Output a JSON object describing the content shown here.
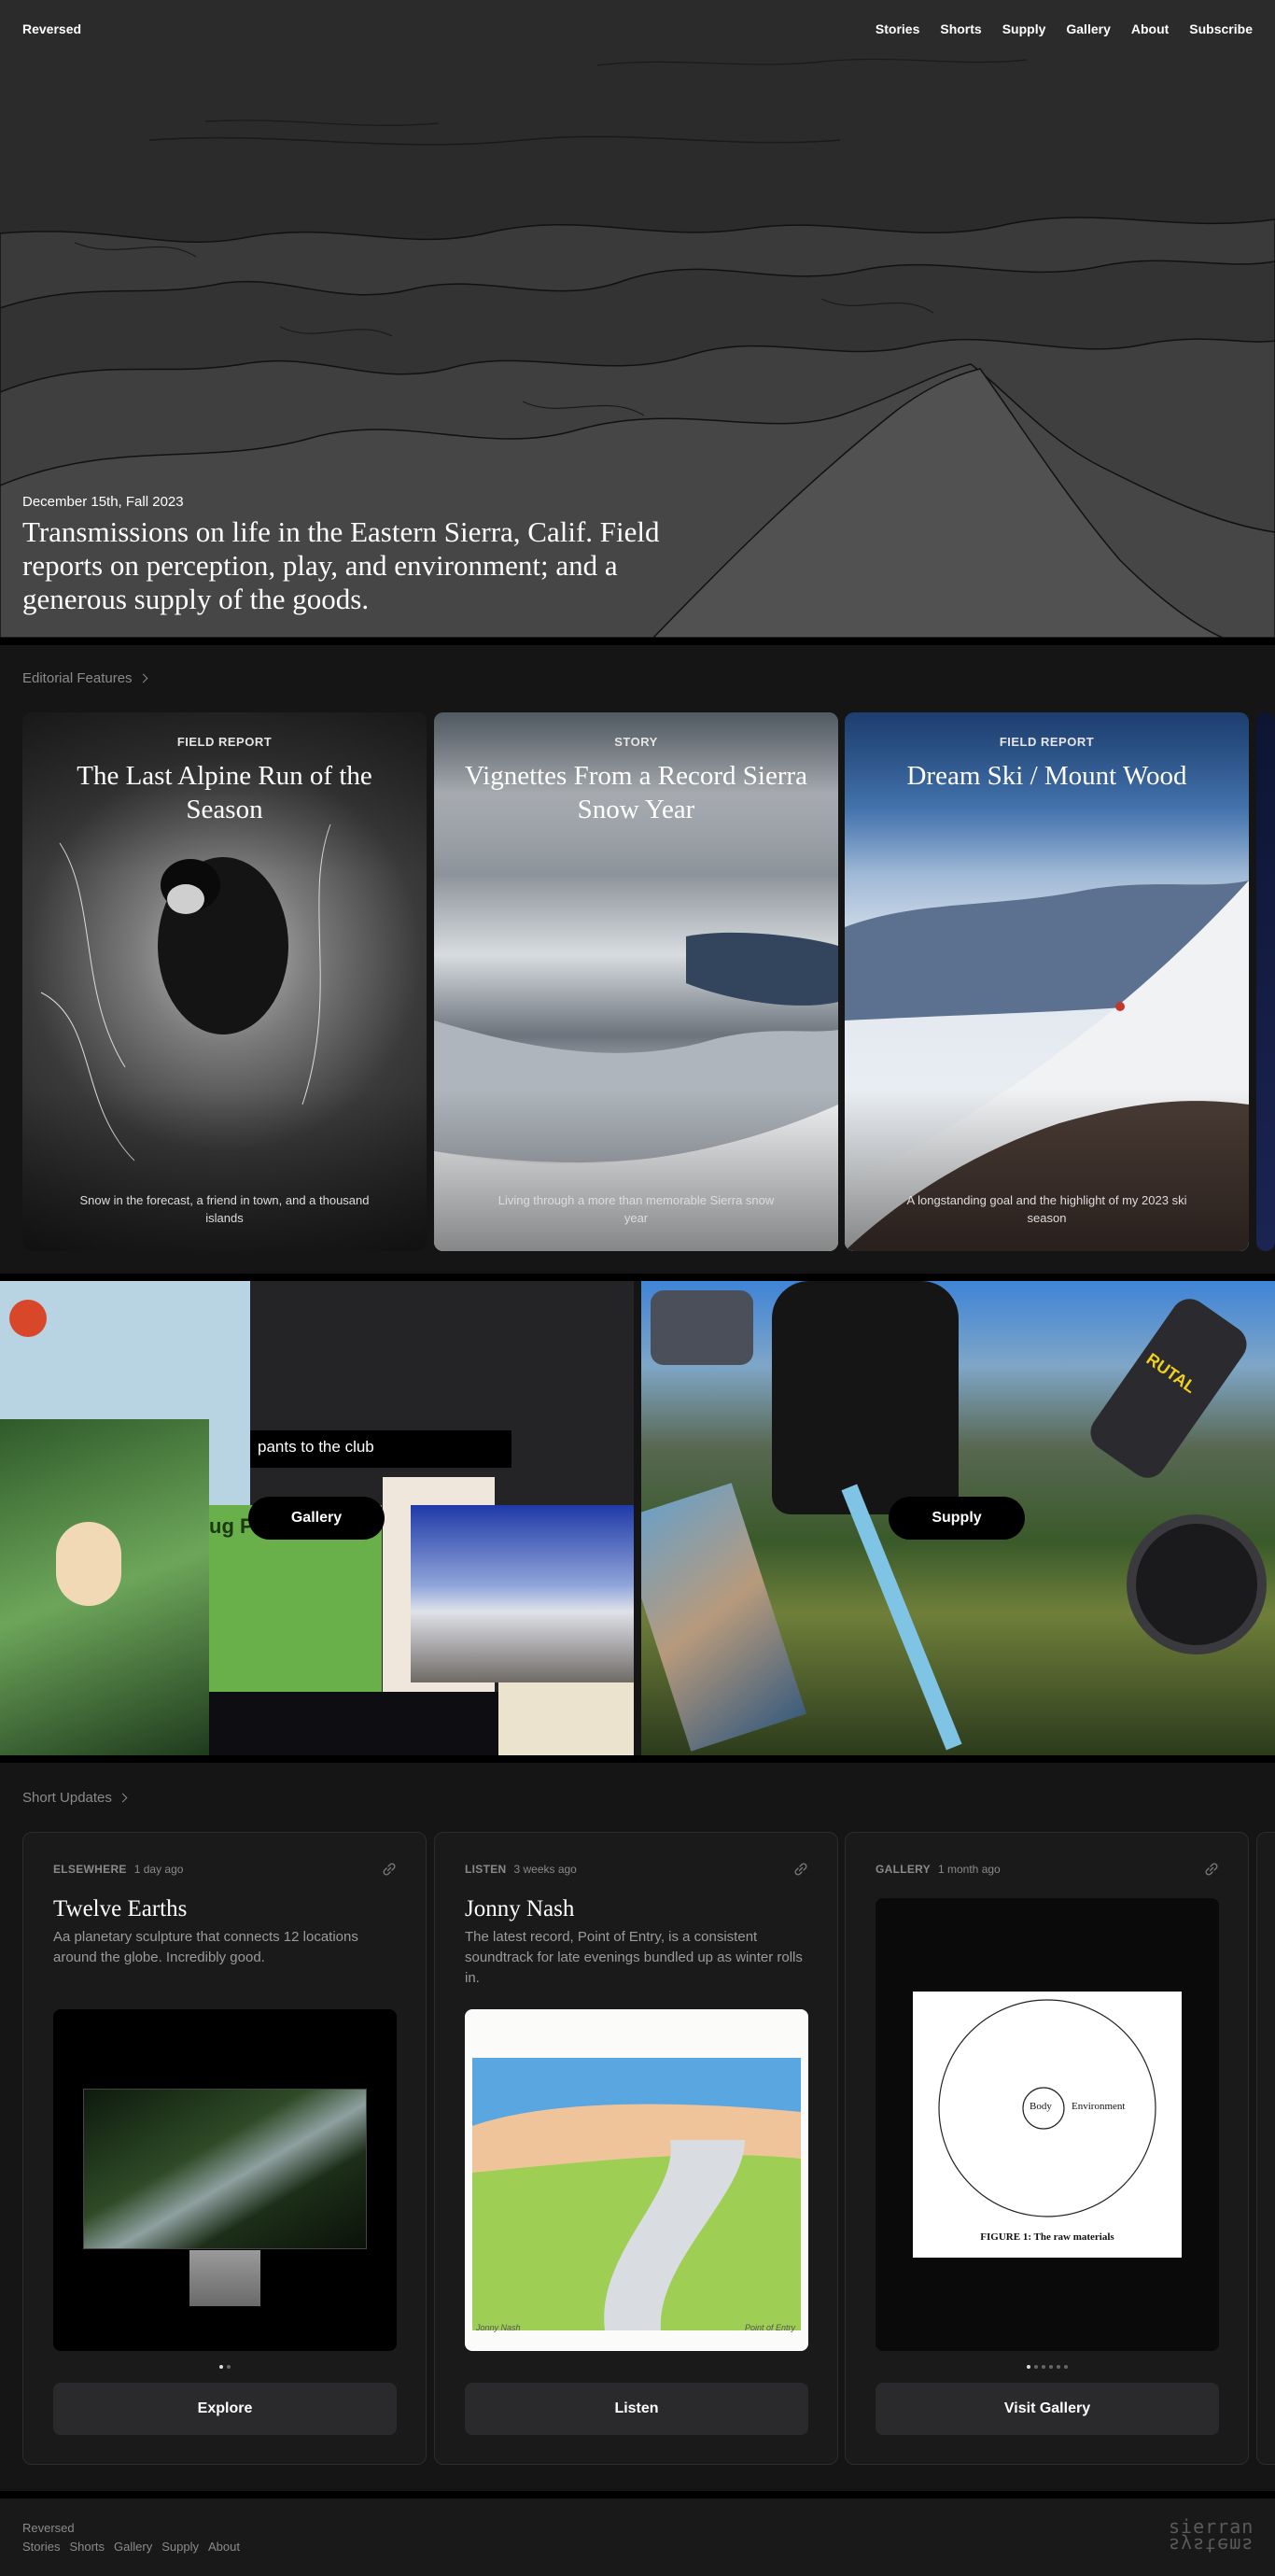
{
  "nav": {
    "brand": "Reversed",
    "links": [
      "Stories",
      "Shorts",
      "Supply",
      "Gallery",
      "About",
      "Subscribe"
    ]
  },
  "hero": {
    "date": "December 15th, Fall 2023",
    "title": "Transmissions on life in the Eastern Sierra, Calif. Field reports on perception, play, and environment; and a generous supply of the goods."
  },
  "editorial": {
    "heading": "Editorial Features",
    "features": [
      {
        "kicker": "FIELD REPORT",
        "title": "The Last Alpine Run of the Season",
        "desc": "Snow in the forecast, a friend in town, and a thousand islands"
      },
      {
        "kicker": "STORY",
        "title": "Vignettes From a Record Sierra Snow Year",
        "desc": "Living through a more than memorable Sierra snow year"
      },
      {
        "kicker": "FIELD REPORT",
        "title": "Dream Ski / Mount Wood",
        "desc": "A longstanding goal and the highlight of my 2023 ski season"
      }
    ]
  },
  "promos": {
    "gallery_label": "Gallery",
    "supply_label": "Supply",
    "gallery_caption": "pants to the club",
    "mug_text": "ug Pants",
    "bottle_text": "RUTAL"
  },
  "shorts": {
    "heading": "Short Updates",
    "cards": [
      {
        "category": "ELSEWHERE",
        "time": "1 day ago",
        "title": "Twelve Earths",
        "desc": "Aa planetary sculpture that connects 12 locations around the globe. Incredibly good.",
        "button": "Explore"
      },
      {
        "category": "LISTEN",
        "time": "3 weeks ago",
        "title": "Jonny Nash",
        "desc": "The latest record, Point of Entry, is a consistent soundtrack for late evenings bundled up as winter rolls in.",
        "button": "Listen",
        "sig_left": "Jonny Nash",
        "sig_right": "Point of Entry"
      },
      {
        "category": "GALLERY",
        "time": "1 month ago",
        "title": "",
        "desc": "",
        "button": "Visit Gallery",
        "fig_body": "Body",
        "fig_env": "Environment",
        "fig_caption": "FIGURE 1: The raw materials"
      }
    ]
  },
  "footer": {
    "brand": "Reversed",
    "links": [
      "Stories",
      "Shorts",
      "Gallery",
      "Supply",
      "About"
    ],
    "logo_top": "sierran",
    "logo_bottom": "systems"
  },
  "colors": {
    "background": "#151516",
    "hero": "#2a2a2b",
    "sky": "#3d7fd6"
  }
}
